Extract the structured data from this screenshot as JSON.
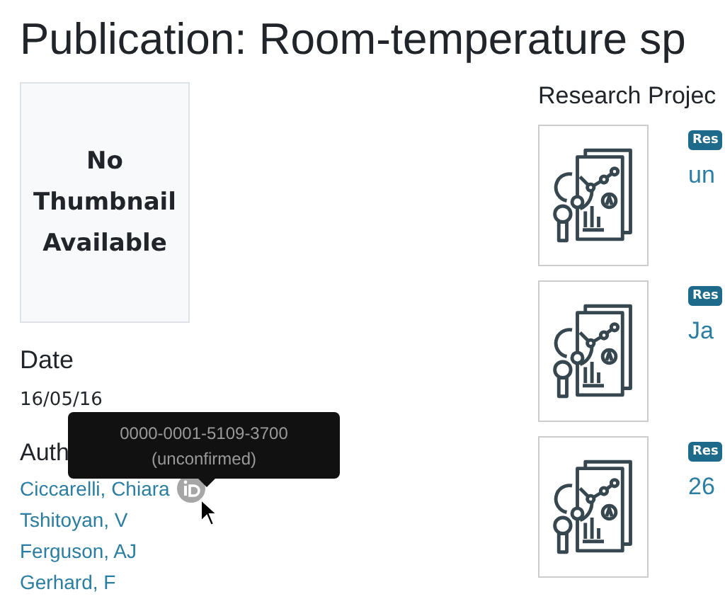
{
  "title": "Publication: Room-temperature sp",
  "thumbnail": {
    "text": "No Thumbnail Available"
  },
  "date": {
    "label": "Date",
    "value": "16/05/16"
  },
  "authors": {
    "label": "Auth",
    "items": [
      {
        "name": "Ciccarelli, Chiara",
        "orcid": true
      },
      {
        "name": "Tshitoyan, V",
        "orcid": false
      },
      {
        "name": "Ferguson, AJ",
        "orcid": false
      },
      {
        "name": "Gerhard, F",
        "orcid": false
      }
    ]
  },
  "tooltip": {
    "id": "0000-0001-5109-3700",
    "note": "(unconfirmed)"
  },
  "projects": {
    "heading": "Research Projec",
    "items": [
      {
        "badge": "Res",
        "title": "un"
      },
      {
        "badge": "Res",
        "title": "Ja"
      },
      {
        "badge": "Res",
        "title": "26"
      }
    ]
  }
}
